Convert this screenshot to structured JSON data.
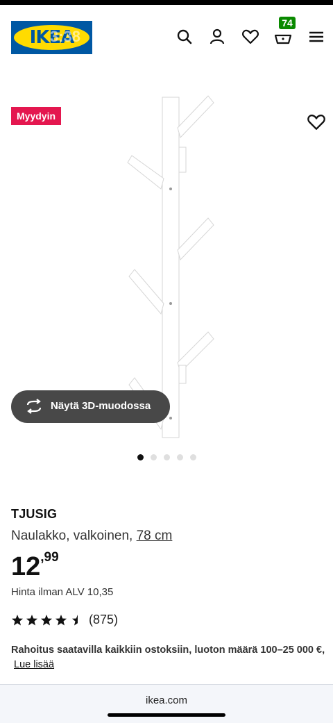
{
  "status": {
    "time": "3:38"
  },
  "header": {
    "logo_text": "IKEA",
    "cart_count": "74",
    "icons": [
      "search-icon",
      "account-icon",
      "favourites-icon",
      "cart-icon",
      "menu-icon"
    ]
  },
  "gallery": {
    "badge": "Myydyin",
    "view_3d_label": "Näytä 3D-muodossa",
    "image_count": 5,
    "active_index": 0
  },
  "product": {
    "name": "TJUSIG",
    "description": "Naulakko, valkoinen,",
    "size": "78 cm",
    "price_int": "12",
    "price_dec": ",99",
    "price_vat": "Hinta ilman ALV 10,35",
    "rating": 4.5,
    "rating_count": "(875)",
    "finance_text": "Rahoitus saatavilla kaikkiin ostoksiin, luoton määrä 100–25 000 €,",
    "finance_link": "Lue lisää"
  },
  "browser": {
    "url": "ikea.com"
  },
  "colors": {
    "ikea_blue": "#0058a3",
    "ikea_yellow": "#ffdb00",
    "badge_red": "#e4174f",
    "cart_badge_green": "#0a8a00",
    "button_dark": "#484848"
  }
}
